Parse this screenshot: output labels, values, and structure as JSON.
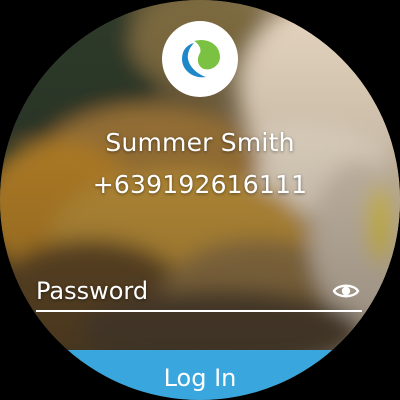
{
  "profile": {
    "name": "Summer Smith",
    "phone": "+639192616111"
  },
  "password_field": {
    "placeholder": "Password",
    "toggle_icon": "eye-icon"
  },
  "login_button": {
    "label": "Log In"
  },
  "logo": {
    "icon": "app-logo-icon"
  },
  "colors": {
    "accent": "#3aa6de",
    "logo_green": "#7cc242",
    "logo_blue": "#1e88c8",
    "text": "#ffffff",
    "background": "#000000"
  }
}
